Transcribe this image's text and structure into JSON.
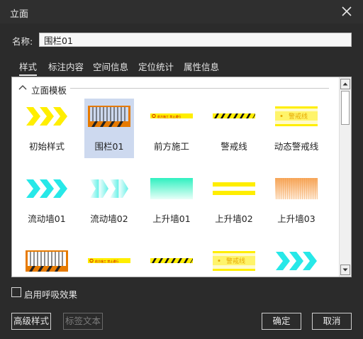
{
  "window": {
    "title": "立面",
    "close_icon": "close-icon"
  },
  "name_field": {
    "label": "名称:",
    "value": "围栏01"
  },
  "tabs": [
    {
      "label": "样式",
      "active": true
    },
    {
      "label": "标注内容",
      "active": false
    },
    {
      "label": "空间信息",
      "active": false
    },
    {
      "label": "定位统计",
      "active": false
    },
    {
      "label": "属性信息",
      "active": false
    }
  ],
  "section": {
    "title": "立面模板",
    "expanded": true
  },
  "templates": [
    {
      "label": "初始样式",
      "icon": "yellow-chevron-arrows",
      "selected": false
    },
    {
      "label": "围栏01",
      "icon": "construction-fence",
      "selected": true
    },
    {
      "label": "前方施工",
      "icon": "construction-ahead-banner",
      "banner_text": "前方施工  禁止通行",
      "selected": false
    },
    {
      "label": "警戒线",
      "icon": "hazard-stripe-tape",
      "selected": false
    },
    {
      "label": "动态警戒线",
      "icon": "dynamic-warning-tape",
      "banner_text": "警戒线",
      "selected": false
    },
    {
      "label": "流动墙01",
      "icon": "cyan-chevron-arrows",
      "selected": false
    },
    {
      "label": "流动墙02",
      "icon": "fading-cyan-chevrons",
      "selected": false
    },
    {
      "label": "上升墙01",
      "icon": "green-gradient-wall",
      "selected": false
    },
    {
      "label": "上升墙02",
      "icon": "yellow-band-wall",
      "selected": false
    },
    {
      "label": "上升墙03",
      "icon": "orange-gradient-wall",
      "selected": false
    },
    {
      "label": "",
      "icon": "construction-fence",
      "selected": false
    },
    {
      "label": "",
      "icon": "construction-ahead-banner",
      "banner_text": "前方施工  禁止通行",
      "selected": false
    },
    {
      "label": "",
      "icon": "hazard-stripe-tape",
      "selected": false
    },
    {
      "label": "",
      "icon": "dynamic-warning-tape",
      "banner_text": "警戒线",
      "selected": false
    },
    {
      "label": "",
      "icon": "cyan-chevron-arrows",
      "selected": false
    }
  ],
  "breathing_effect": {
    "label": "启用呼吸效果",
    "checked": false
  },
  "buttons": {
    "advanced_style": "高级样式",
    "label_text": "标签文本",
    "confirm": "确定",
    "cancel": "取消"
  },
  "colors": {
    "dialog_bg": "#2b2b2b",
    "selected_tile": "#cdd9ef",
    "hazard_yellow": "#ffee00",
    "cyan": "#27e8e8"
  }
}
